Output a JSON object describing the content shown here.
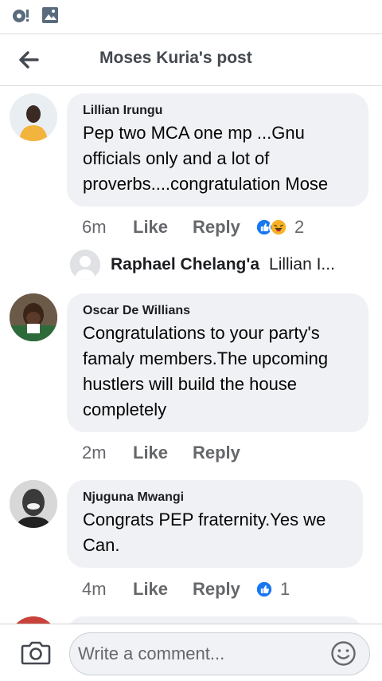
{
  "header": {
    "title": "Moses Kuria's post"
  },
  "icons": {
    "status_left": "record-icon",
    "status_gallery": "gallery-icon",
    "back": "arrow-left-icon",
    "camera": "camera-icon",
    "emoji": "emoji-icon",
    "like_reaction": "like-reaction-icon",
    "haha_reaction": "haha-reaction-icon"
  },
  "colors": {
    "like_blue": "#1877f2",
    "bubble_bg": "#eff1f4",
    "meta_gray": "#65676b",
    "haha_yellow": "#f7b125"
  },
  "comments": [
    {
      "author": "Lillian Irungu",
      "text": "Pep two MCA one mp ...Gnu officials only and a lot of proverbs....congratulation Mose",
      "time": "6m",
      "like_label": "Like",
      "reply_label": "Reply",
      "reaction_count": "2"
    },
    {
      "author": "Oscar De Willians",
      "text": "Congratulations to your party's famaly members.The upcoming hustlers will build the house completely",
      "time": "2m",
      "like_label": "Like",
      "reply_label": "Reply"
    },
    {
      "author": "Njuguna Mwangi",
      "text": "Congrats PEP fraternity.Yes we Can.",
      "time": "4m",
      "like_label": "Like",
      "reply_label": "Reply",
      "reaction_count": "1"
    }
  ],
  "reply_preview": {
    "author": "Raphael Chelang'a",
    "snippet": "Lillian I..."
  },
  "composer": {
    "placeholder": "Write a comment..."
  }
}
